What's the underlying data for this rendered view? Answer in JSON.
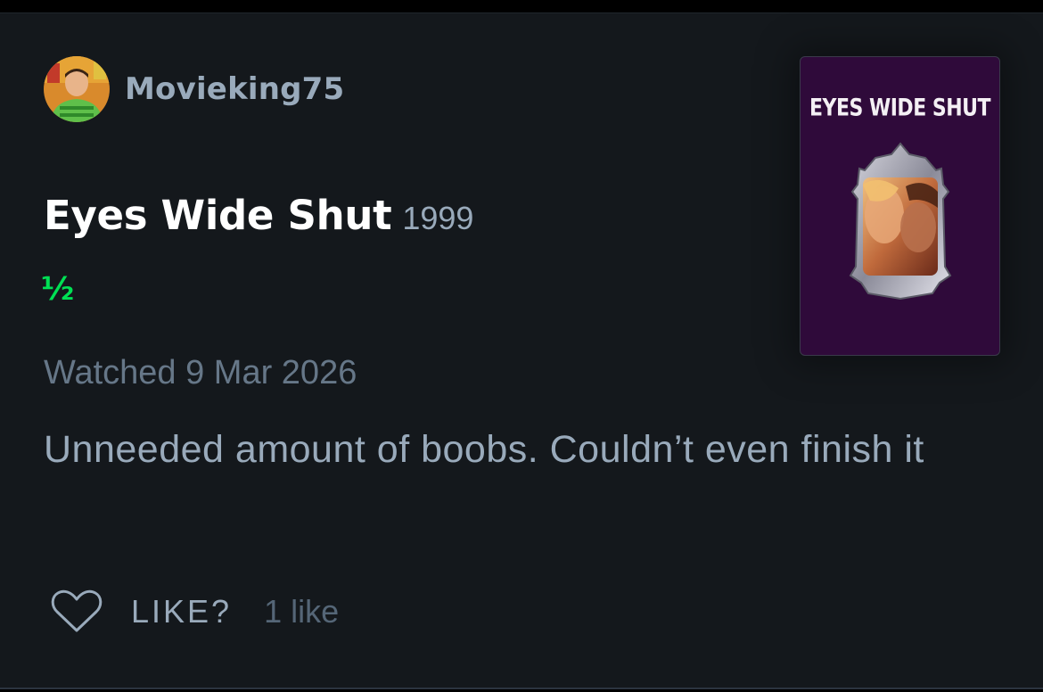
{
  "review": {
    "username": "Movieking75",
    "film_title": "Eyes Wide Shut",
    "film_year": "1999",
    "rating": "½",
    "watched": "Watched 9 Mar 2026",
    "text": "Unneeded amount of boobs. Couldn’t even finish it"
  },
  "poster": {
    "title": "EYES WIDE SHUT",
    "background": "#2f0a3a"
  },
  "actions": {
    "heart_icon": "heart-outline-icon",
    "like_label": "LIKE?",
    "like_count": "1 like"
  },
  "colors": {
    "background": "#14181c",
    "accent_green": "#00e054",
    "text_primary": "#ffffff",
    "text_secondary": "#99aabb",
    "text_muted": "#667788"
  }
}
